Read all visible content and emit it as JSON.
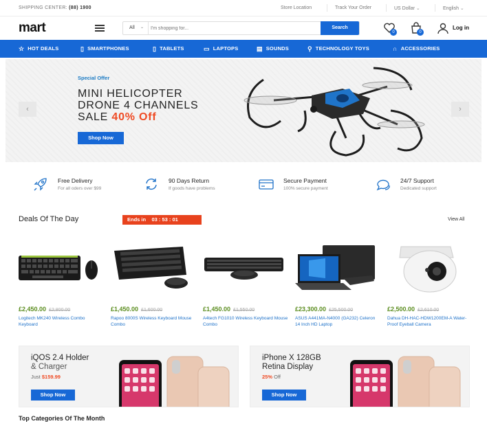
{
  "topbar": {
    "shipping_label": "SHIPPING CENTER:",
    "shipping_phone": "(88) 1900",
    "store_location": "Store Location",
    "track_order": "Track Your Order",
    "currency": "US Dollar",
    "language": "English"
  },
  "header": {
    "logo": "mart",
    "search_category": "All",
    "search_placeholder": "I'm shopping for...",
    "search_button": "Search",
    "wishlist_count": "0",
    "cart_count": "0",
    "login_label": "Log in"
  },
  "nav": {
    "items": [
      {
        "label": "HOT DEALS",
        "icon": "star-icon"
      },
      {
        "label": "SMARTPHONES",
        "icon": "phone-icon"
      },
      {
        "label": "TABLETS",
        "icon": "tablet-icon"
      },
      {
        "label": "LAPTOPS",
        "icon": "laptop-icon"
      },
      {
        "label": "SOUNDS",
        "icon": "speaker-icon"
      },
      {
        "label": "TECHNOLOGY TOYS",
        "icon": "toy-icon"
      },
      {
        "label": "ACCESSORIES",
        "icon": "headphones-icon"
      }
    ]
  },
  "hero": {
    "subtitle": "Special Offer",
    "line1": "MINI HELICOPTER",
    "line2": "DRONE 4 CHANNELS",
    "line3": "SALE",
    "discount": "40% Off",
    "button": "Shop Now",
    "prev": "‹",
    "next": "›"
  },
  "features": [
    {
      "title": "Free Delivery",
      "sub": "For all oders over $99",
      "icon": "rocket-icon"
    },
    {
      "title": "90 Days Return",
      "sub": "If goods have problems",
      "icon": "refresh-icon"
    },
    {
      "title": "Secure Payment",
      "sub": "100% secure payment",
      "icon": "credit-card-icon"
    },
    {
      "title": "24/7 Support",
      "sub": "Dedicated support",
      "icon": "chat-icon"
    }
  ],
  "deals": {
    "title": "Deals Of The Day",
    "ends_label": "Ends in",
    "timer": "03 : 53 : 01",
    "view_all": "View All",
    "products": [
      {
        "price": "£2,450.00",
        "old": "£2,800.00",
        "name": "Logitech MK240 Wireless Combo Keyboard"
      },
      {
        "price": "£1,450.00",
        "old": "£1,600.00",
        "name": "Rapoo 8000S Wireless Keyboard Mouse Combo"
      },
      {
        "price": "£1,450.00",
        "old": "£1,550.00",
        "name": "A4tech FG1010 Wireless Keyboard Mouse Combo"
      },
      {
        "price": "£23,300.00",
        "old": "£25,500.00",
        "name": "ASUS A441MA-N4000 (GA232) Celeron 14 Inch HD Laptop"
      },
      {
        "price": "£2,500.00",
        "old": "£2,610.00",
        "name": "Dahua DH-HAC-HDW1200EM-A Water-Proof Eyeball Camera"
      }
    ]
  },
  "promos": [
    {
      "line1": "iQOS 2.4 Holder",
      "line2": "& Charger",
      "sub_prefix": "Just",
      "sub_value": "$159.99",
      "button": "Shop Now"
    },
    {
      "line1": "iPhone X 128GB",
      "line2": "Retina Display",
      "sub_prefix": "",
      "sub_value": "25%",
      "sub_suffix": "Off",
      "button": "Shop Now"
    }
  ],
  "top_categories_title": "Top Categories Of The Month",
  "colors": {
    "primary": "#1768d6",
    "accent": "#ef4a23",
    "price": "#5b8d1f",
    "link": "#1c70c8"
  }
}
